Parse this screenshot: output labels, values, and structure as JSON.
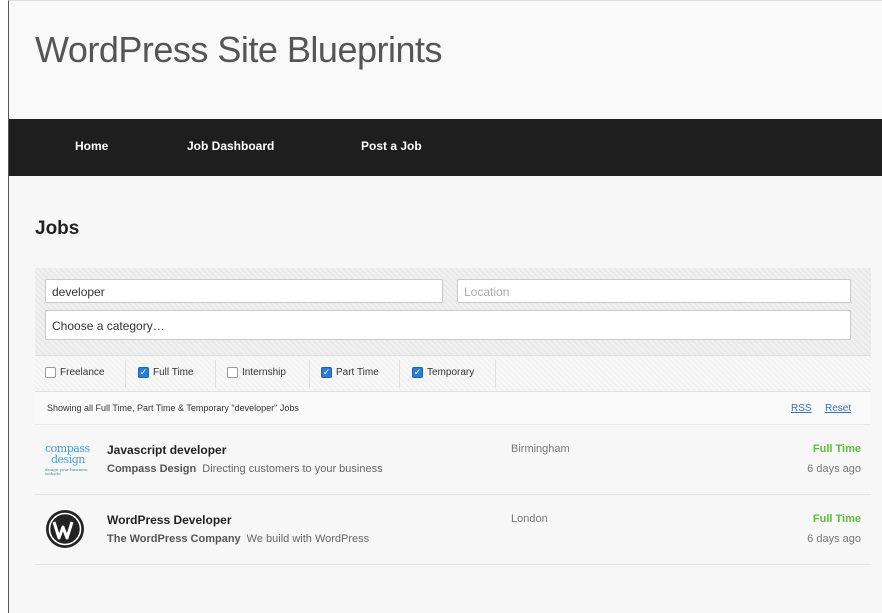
{
  "site": {
    "title": "WordPress Site Blueprints"
  },
  "nav": {
    "items": [
      "Home",
      "Job Dashboard",
      "Post a Job"
    ]
  },
  "page": {
    "title": "Jobs"
  },
  "filters": {
    "keywords_value": "developer",
    "location_placeholder": "Location",
    "category_placeholder": "Choose a category…",
    "job_types": [
      {
        "label": "Freelance",
        "checked": false
      },
      {
        "label": "Full Time",
        "checked": true
      },
      {
        "label": "Internship",
        "checked": false
      },
      {
        "label": "Part Time",
        "checked": true
      },
      {
        "label": "Temporary",
        "checked": true
      }
    ]
  },
  "results": {
    "summary": "Showing all Full Time, Part Time & Temporary \"developer\" Jobs",
    "rss_label": "RSS",
    "reset_label": "Reset"
  },
  "jobs": [
    {
      "title": "Javascript developer",
      "company": "Compass Design",
      "tagline": "Directing customers to your business",
      "location": "Birmingham",
      "type": "Full Time",
      "date": "6 days ago",
      "logo": "compass-design-logo"
    },
    {
      "title": "WordPress Developer",
      "company": "The WordPress Company",
      "tagline": "We build with WordPress",
      "location": "London",
      "type": "Full Time",
      "date": "6 days ago",
      "logo": "wordpress-logo"
    }
  ],
  "colors": {
    "nav_bg": "#1e1e1e",
    "job_type_green": "#5cbd3a",
    "link_blue": "#3a6db5",
    "checkbox_blue": "#2a7fd4"
  }
}
